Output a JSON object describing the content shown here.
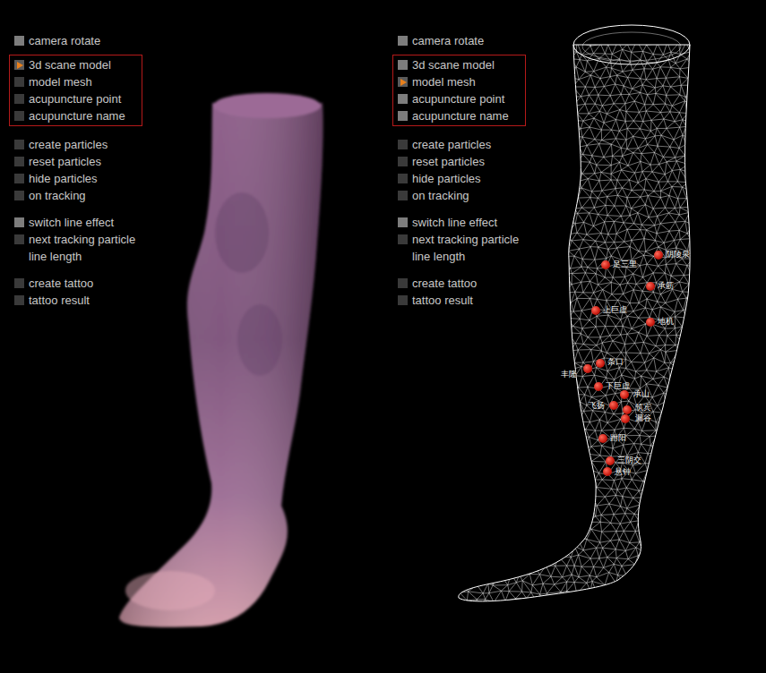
{
  "panels": [
    {
      "model": "scan",
      "menu": [
        {
          "framed": false,
          "items": [
            {
              "label": "camera rotate",
              "kind": "toggle",
              "selected": false,
              "lit": true
            }
          ]
        },
        {
          "framed": true,
          "items": [
            {
              "label": "3d scane model",
              "kind": "toggle",
              "selected": true,
              "lit": false
            },
            {
              "label": "model mesh",
              "kind": "toggle",
              "selected": false,
              "lit": false
            },
            {
              "label": "acupuncture point",
              "kind": "toggle",
              "selected": false,
              "lit": false
            },
            {
              "label": "acupuncture name",
              "kind": "toggle",
              "selected": false,
              "lit": false
            }
          ]
        },
        {
          "framed": false,
          "items": [
            {
              "label": "create particles",
              "kind": "toggle",
              "selected": false,
              "lit": false
            },
            {
              "label": "reset particles",
              "kind": "toggle",
              "selected": false,
              "lit": false
            },
            {
              "label": "hide particles",
              "kind": "toggle",
              "selected": false,
              "lit": false
            },
            {
              "label": "on tracking",
              "kind": "toggle",
              "selected": false,
              "lit": false
            }
          ]
        },
        {
          "framed": false,
          "items": [
            {
              "label": "switch line effect",
              "kind": "toggle",
              "selected": false,
              "lit": true
            },
            {
              "label": "next tracking particle",
              "kind": "toggle",
              "selected": false,
              "lit": false
            },
            {
              "label": "line length",
              "kind": "label",
              "selected": false,
              "lit": false
            }
          ]
        },
        {
          "framed": false,
          "items": [
            {
              "label": "create tattoo",
              "kind": "toggle",
              "selected": false,
              "lit": false
            },
            {
              "label": "tattoo result",
              "kind": "toggle",
              "selected": false,
              "lit": false
            }
          ]
        }
      ],
      "points": []
    },
    {
      "model": "mesh",
      "menu": [
        {
          "framed": false,
          "items": [
            {
              "label": "camera rotate",
              "kind": "toggle",
              "selected": false,
              "lit": true
            }
          ]
        },
        {
          "framed": true,
          "items": [
            {
              "label": "3d scane model",
              "kind": "toggle",
              "selected": false,
              "lit": true
            },
            {
              "label": "model mesh",
              "kind": "toggle",
              "selected": true,
              "lit": false
            },
            {
              "label": "acupuncture point",
              "kind": "toggle",
              "selected": false,
              "lit": true
            },
            {
              "label": "acupuncture name",
              "kind": "toggle",
              "selected": false,
              "lit": true
            }
          ]
        },
        {
          "framed": false,
          "items": [
            {
              "label": "create particles",
              "kind": "toggle",
              "selected": false,
              "lit": false
            },
            {
              "label": "reset particles",
              "kind": "toggle",
              "selected": false,
              "lit": false
            },
            {
              "label": "hide particles",
              "kind": "toggle",
              "selected": false,
              "lit": false
            },
            {
              "label": "on tracking",
              "kind": "toggle",
              "selected": false,
              "lit": false
            }
          ]
        },
        {
          "framed": false,
          "items": [
            {
              "label": "switch line effect",
              "kind": "toggle",
              "selected": false,
              "lit": true
            },
            {
              "label": "next tracking particle",
              "kind": "toggle",
              "selected": false,
              "lit": false
            },
            {
              "label": "line length",
              "kind": "label",
              "selected": false,
              "lit": false
            }
          ]
        },
        {
          "framed": false,
          "items": [
            {
              "label": "create tattoo",
              "kind": "toggle",
              "selected": false,
              "lit": false
            },
            {
              "label": "tattoo result",
              "kind": "toggle",
              "selected": false,
              "lit": false
            }
          ]
        }
      ],
      "points": [
        "足三里",
        "阴陵泉",
        "承筋",
        "上巨虚",
        "地机",
        "条口",
        "丰隆",
        "下巨虚",
        "承山",
        "飞扬",
        "筑宾",
        "漏谷",
        "跗阳",
        "三阴交",
        "悬钟"
      ]
    }
  ]
}
